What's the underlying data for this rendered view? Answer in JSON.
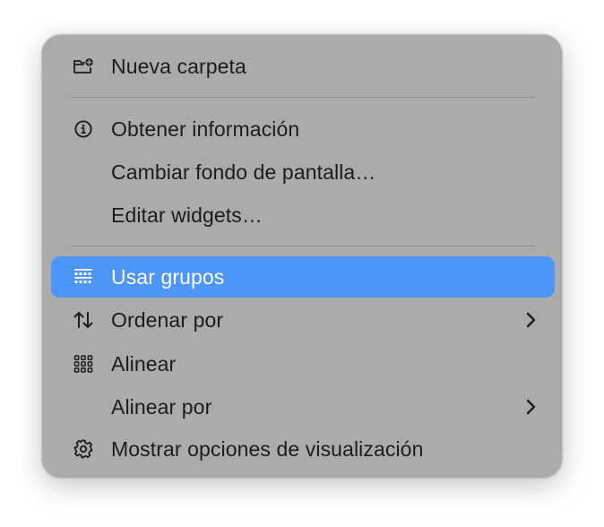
{
  "menu": {
    "items": [
      {
        "label": "Nueva carpeta",
        "icon": "new-folder-icon",
        "selected": false,
        "submenu": false
      },
      {
        "label": "Obtener información",
        "icon": "info-circle-icon",
        "selected": false,
        "submenu": false
      },
      {
        "label": "Cambiar fondo de pantalla…",
        "icon": null,
        "selected": false,
        "submenu": false
      },
      {
        "label": "Editar widgets…",
        "icon": null,
        "selected": false,
        "submenu": false
      },
      {
        "label": "Usar grupos",
        "icon": "stacks-icon",
        "selected": true,
        "submenu": false
      },
      {
        "label": "Ordenar por",
        "icon": "sort-arrows-icon",
        "selected": false,
        "submenu": true
      },
      {
        "label": "Alinear",
        "icon": "grid-dots-icon",
        "selected": false,
        "submenu": false
      },
      {
        "label": "Alinear por",
        "icon": null,
        "selected": false,
        "submenu": true
      },
      {
        "label": "Mostrar opciones de visualización",
        "icon": "gear-icon",
        "selected": false,
        "submenu": false
      }
    ]
  },
  "colors": {
    "menu_background": "#ababab",
    "selection": "#4d95f7",
    "text": "#1c1c1c",
    "selected_text": "#ffffff",
    "separator": "#8f8f8f"
  }
}
